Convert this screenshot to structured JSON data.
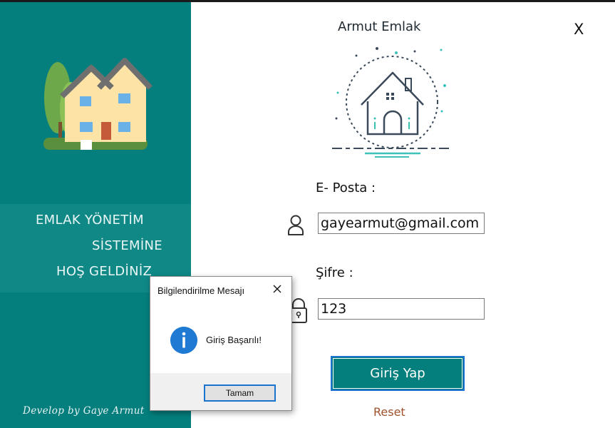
{
  "window": {
    "title": "Armut Emlak",
    "close_label": "X"
  },
  "sidebar": {
    "welcome_lines": [
      "EMLAK YÖNETİM",
      "SİSTEMİNE",
      "HOŞ GELDİNİZ"
    ],
    "developer_credit": "Develop by Gaye Armut",
    "logo_icon": "house-tree-icon"
  },
  "login": {
    "logo_icon": "house-circle-icon",
    "email_label": "E- Posta :",
    "email_value": "gayearmut@gmail.com",
    "email_icon": "user-icon",
    "password_label": "Şifre :",
    "password_value": "123",
    "password_icon": "lock-icon",
    "submit_label": "Giriş Yap",
    "reset_label": "Reset"
  },
  "dialog": {
    "title": "Bilgilendirilme Mesajı",
    "message": "Giriş Başarılı!",
    "ok_label": "Tamam",
    "info_icon": "info-icon",
    "close_icon": "close-icon"
  },
  "colors": {
    "sidebar": "#047f7d",
    "accent_border": "#1b73d0",
    "reset_link": "#a0522d"
  }
}
